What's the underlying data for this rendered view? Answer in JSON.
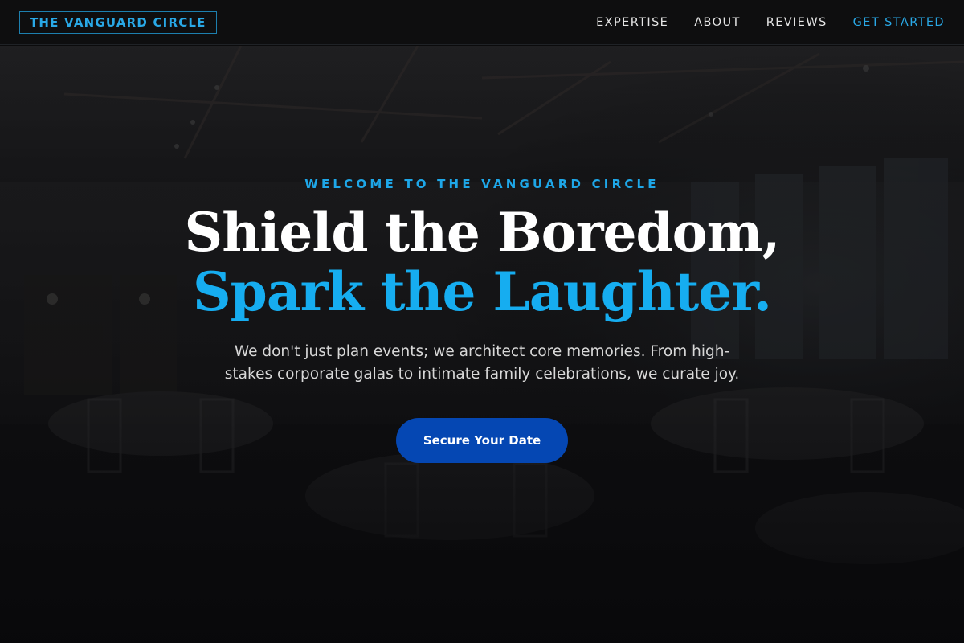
{
  "nav": {
    "logo": "THE VANGUARD CIRCLE",
    "links": [
      "EXPERTISE",
      "ABOUT",
      "REVIEWS",
      "GET STARTED"
    ]
  },
  "hero": {
    "eyebrow": "WELCOME TO THE VANGUARD CIRCLE",
    "headline_line1": "Shield the Boredom,",
    "headline_line2": "Spark the Laughter.",
    "subtext": "We don't just plan events; we architect core memories. From high-stakes corporate galas to intimate family celebrations, we curate joy.",
    "cta_label": "Secure Your Date"
  },
  "colors": {
    "accent": "#16adf0",
    "cta": "#0547b3",
    "background": "#0b0b0c"
  }
}
